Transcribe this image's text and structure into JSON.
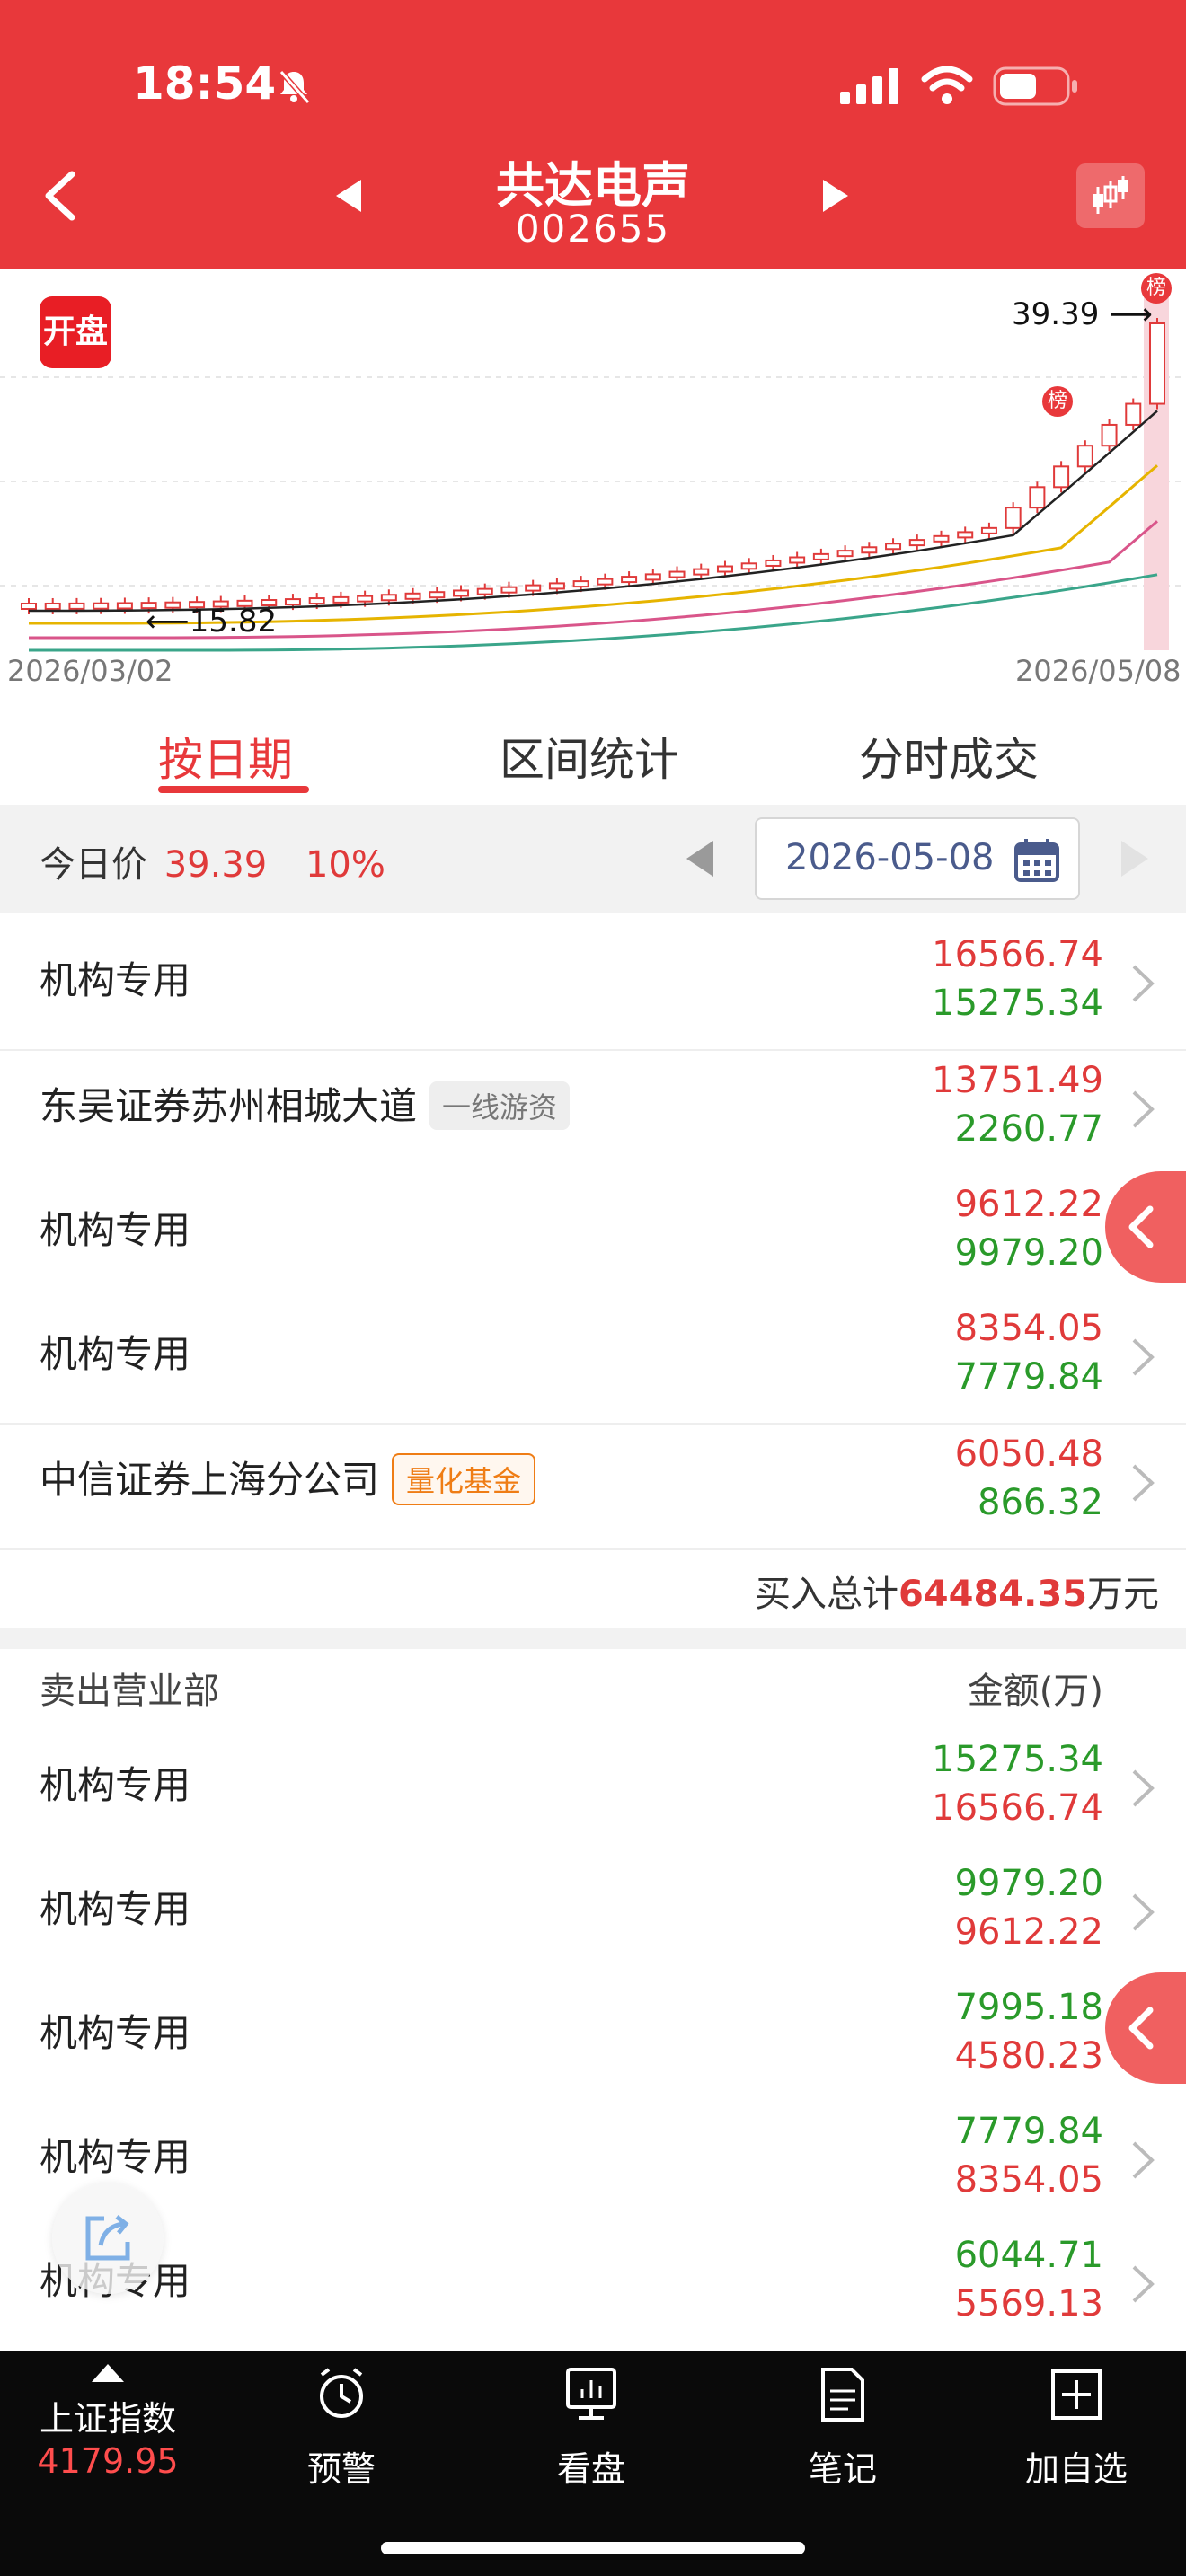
{
  "status_bar": {
    "time": "18:54"
  },
  "header": {
    "title": "共达电声",
    "code": "002655"
  },
  "chart": {
    "badge": "开盘",
    "high_label": "39.39",
    "low_label": "15.82",
    "start_date": "2026/03/02",
    "end_date": "2026/05/08",
    "marker": "榜",
    "colors": {
      "up": "#e03a3a",
      "down": "#2a8a2a",
      "ma5": "#222222",
      "ma10": "#e6b400",
      "ma20": "#d9558a",
      "ma30": "#3aa58a"
    }
  },
  "tabs": [
    {
      "label": "按日期",
      "active": true
    },
    {
      "label": "区间统计",
      "active": false
    },
    {
      "label": "分时成交",
      "active": false
    }
  ],
  "price_bar": {
    "label": "今日价",
    "price": "39.39",
    "change": "10%",
    "date": "2026-05-08"
  },
  "buy_list": [
    {
      "name": "机构专用",
      "tag": "",
      "buy": "16566.74",
      "sell": "15275.34"
    },
    {
      "name": "东吴证券苏州相城大道",
      "tag": "一线游资",
      "buy": "13751.49",
      "sell": "2260.77"
    },
    {
      "name": "机构专用",
      "tag": "",
      "buy": "9612.22",
      "sell": "9979.20"
    },
    {
      "name": "机构专用",
      "tag": "",
      "buy": "8354.05",
      "sell": "7779.84"
    },
    {
      "name": "中信证券上海分公司",
      "tag": "量化基金",
      "buy": "6050.48",
      "sell": "866.32"
    }
  ],
  "buy_total": {
    "label": "买入总计",
    "value": "64484.35",
    "unit": "万元"
  },
  "sell_header": {
    "left": "卖出营业部",
    "right": "金额(万)"
  },
  "sell_list": [
    {
      "name": "机构专用",
      "sell": "15275.34",
      "buy": "16566.74"
    },
    {
      "name": "机构专用",
      "sell": "9979.20",
      "buy": "9612.22"
    },
    {
      "name": "机构专用",
      "sell": "7995.18",
      "buy": "4580.23"
    },
    {
      "name": "机构专用",
      "sell": "7779.84",
      "buy": "8354.05"
    },
    {
      "name": "机构专用",
      "sell": "6044.71",
      "buy": "5569.13"
    }
  ],
  "bottom_nav": {
    "index_name": "上证指数",
    "index_value": "4179.95",
    "items": [
      {
        "label": "预警",
        "icon": "alarm-clock-icon"
      },
      {
        "label": "看盘",
        "icon": "monitor-chart-icon"
      },
      {
        "label": "笔记",
        "icon": "note-icon"
      },
      {
        "label": "加自选",
        "icon": "plus-box-icon"
      }
    ]
  }
}
